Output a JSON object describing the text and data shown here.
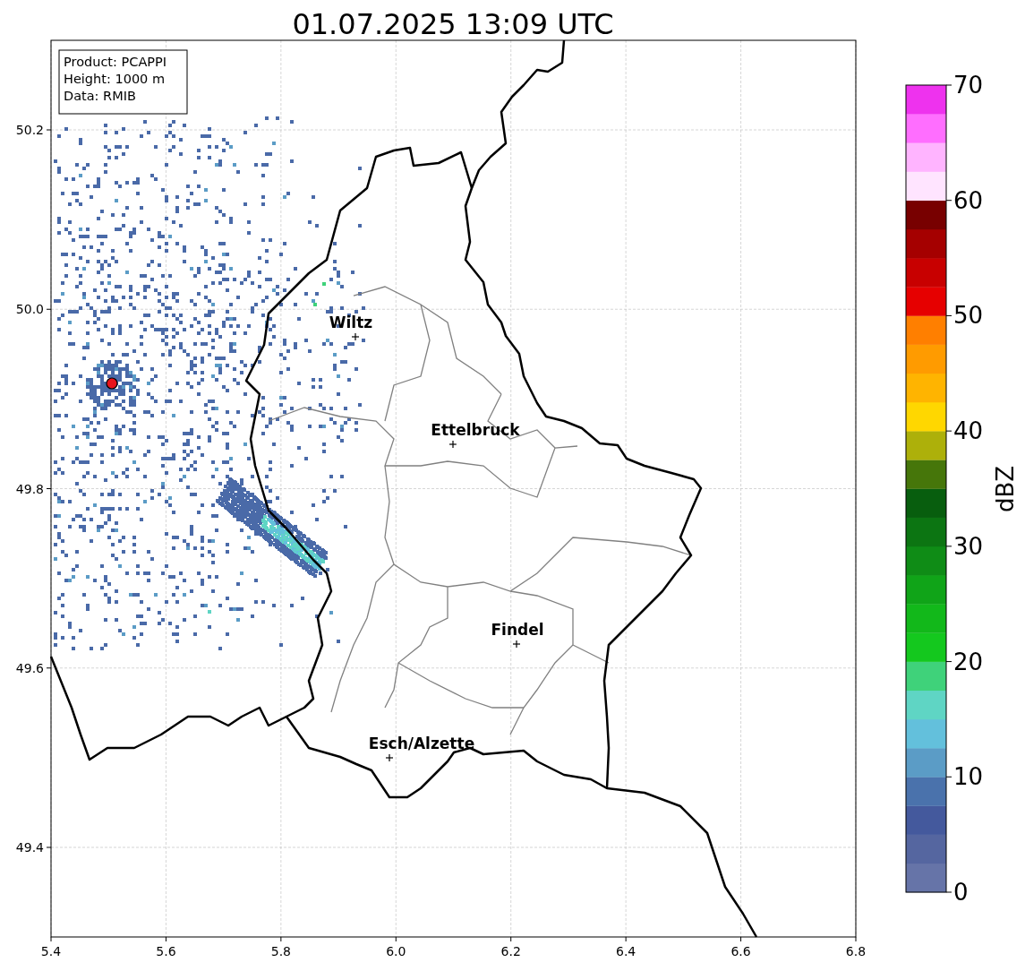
{
  "title": "01.07.2025 13:09 UTC",
  "info_box": [
    "Product: PCAPPI",
    "Height: 1000 m",
    "Data: RMIB"
  ],
  "cities": [
    {
      "name": "Wiltz"
    },
    {
      "name": "Ettelbruck"
    },
    {
      "name": "Findel"
    },
    {
      "name": "Esch/Alzette"
    }
  ],
  "xticks": [
    "5.4",
    "5.6",
    "5.8",
    "6.0",
    "6.2",
    "6.4",
    "6.6",
    "6.8"
  ],
  "yticks": [
    "50.2",
    "50.0",
    "49.8",
    "49.6",
    "49.4"
  ],
  "colorbar": {
    "label": "dBZ",
    "ticks": [
      "70",
      "60",
      "50",
      "40",
      "30",
      "20",
      "10",
      "0"
    ],
    "bands": [
      {
        "color": "#6674a8"
      },
      {
        "color": "#5566a0"
      },
      {
        "color": "#44599d"
      },
      {
        "color": "#4a72ac"
      },
      {
        "color": "#5b9cc6"
      },
      {
        "color": "#63c0dc"
      },
      {
        "color": "#5fd5c4"
      },
      {
        "color": "#3fd27a"
      },
      {
        "color": "#14c81e"
      },
      {
        "color": "#12b81a"
      },
      {
        "color": "#10a418"
      },
      {
        "color": "#0f8c16"
      },
      {
        "color": "#0c7512"
      },
      {
        "color": "#085e0e"
      },
      {
        "color": "#46760a"
      },
      {
        "color": "#adb00a"
      },
      {
        "color": "#ffd700"
      },
      {
        "color": "#ffb400"
      },
      {
        "color": "#ff9b00"
      },
      {
        "color": "#ff7f00"
      },
      {
        "color": "#e60000"
      },
      {
        "color": "#c80000"
      },
      {
        "color": "#a50000"
      },
      {
        "color": "#780000"
      },
      {
        "color": "#ffe4ff"
      },
      {
        "color": "#ffb4ff"
      },
      {
        "color": "#ff6eff"
      },
      {
        "color": "#ee32ee"
      }
    ]
  }
}
